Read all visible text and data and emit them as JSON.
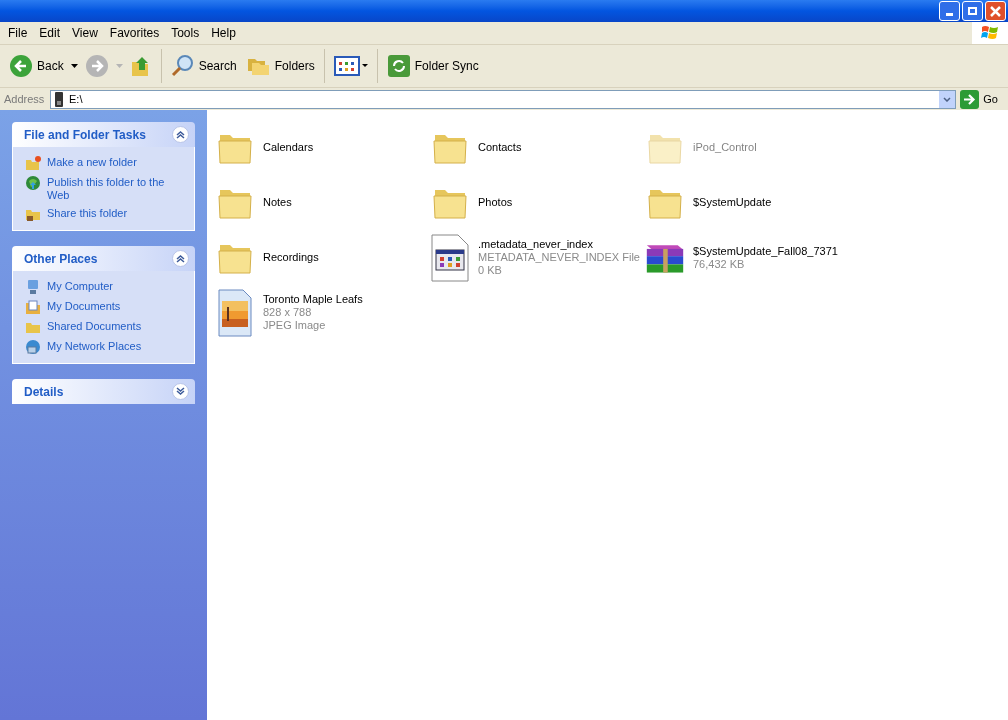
{
  "menu": [
    "File",
    "Edit",
    "View",
    "Favorites",
    "Tools",
    "Help"
  ],
  "toolbar": [
    {
      "kind": "back",
      "label": "Back",
      "disabled": false
    },
    {
      "kind": "forward",
      "disabled": true
    },
    {
      "kind": "up"
    },
    {
      "kind": "search",
      "label": "Search"
    },
    {
      "kind": "folders",
      "label": "Folders"
    },
    {
      "kind": "views"
    },
    {
      "kind": "sync",
      "label": "Folder Sync"
    }
  ],
  "address": {
    "label": "Address",
    "value": "E:\\",
    "go": "Go"
  },
  "panels": [
    {
      "title": "File and Folder Tasks",
      "expanded": true,
      "items": [
        {
          "kind": "newfolder",
          "label": "Make a new folder"
        },
        {
          "kind": "publish",
          "label": "Publish this folder to the Web"
        },
        {
          "kind": "share",
          "label": "Share this folder"
        }
      ]
    },
    {
      "title": "Other Places",
      "expanded": true,
      "items": [
        {
          "kind": "computer",
          "label": "My Computer"
        },
        {
          "kind": "documents",
          "label": "My Documents"
        },
        {
          "kind": "folder",
          "label": "Shared Documents"
        },
        {
          "kind": "network",
          "label": "My Network Places"
        }
      ]
    },
    {
      "title": "Details",
      "expanded": false
    }
  ],
  "files": [
    {
      "kind": "folder",
      "name": "Calendars",
      "hidden": false
    },
    {
      "kind": "folder",
      "name": "Contacts",
      "hidden": false
    },
    {
      "kind": "folder",
      "name": "iPod_Control",
      "hidden": true
    },
    {
      "kind": "folder",
      "name": "Notes",
      "hidden": false
    },
    {
      "kind": "folder",
      "name": "Photos",
      "hidden": false
    },
    {
      "kind": "folder",
      "name": "$SystemUpdate",
      "hidden": false
    },
    {
      "kind": "folder",
      "name": "Recordings",
      "hidden": false
    },
    {
      "kind": "file",
      "name": ".metadata_never_index",
      "details": [
        "METADATA_NEVER_INDEX File",
        "0 KB"
      ],
      "hidden": false
    },
    {
      "kind": "archive",
      "name": "$SystemUpdate_Fall08_7371",
      "details": [
        "76,432 KB"
      ],
      "hidden": false
    },
    {
      "kind": "image",
      "name": "Toronto Maple Leafs",
      "details": [
        "828 x 788",
        "JPEG Image"
      ],
      "hidden": false
    }
  ]
}
